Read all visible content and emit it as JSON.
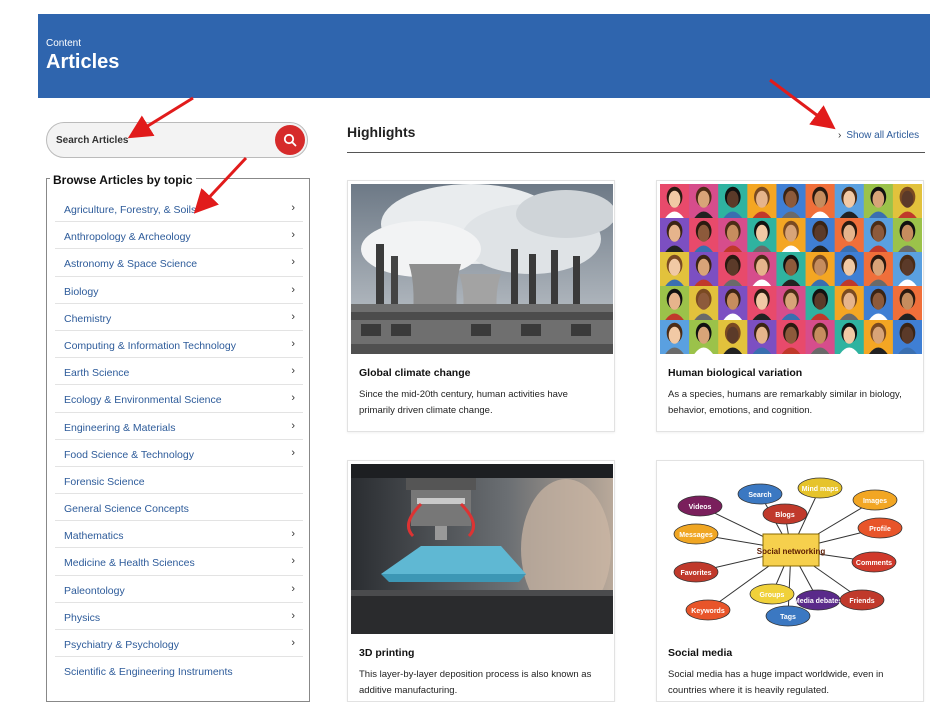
{
  "header": {
    "eyebrow": "Content",
    "title": "Articles"
  },
  "search": {
    "placeholder": "Search Articles",
    "icon": "search-icon",
    "button_color": "#d62b2b"
  },
  "topics": {
    "heading": "Browse Articles by topic",
    "items": [
      {
        "label": "Agriculture, Forestry, & Soils",
        "has_chevron": true
      },
      {
        "label": "Anthropology & Archeology",
        "has_chevron": true
      },
      {
        "label": "Astronomy & Space Science",
        "has_chevron": true
      },
      {
        "label": "Biology",
        "has_chevron": true
      },
      {
        "label": "Chemistry",
        "has_chevron": true
      },
      {
        "label": "Computing & Information Technology",
        "has_chevron": true
      },
      {
        "label": "Earth Science",
        "has_chevron": true
      },
      {
        "label": "Ecology & Environmental Science",
        "has_chevron": true
      },
      {
        "label": "Engineering & Materials",
        "has_chevron": true
      },
      {
        "label": "Food Science & Technology",
        "has_chevron": true
      },
      {
        "label": "Forensic Science",
        "has_chevron": false
      },
      {
        "label": "General Science Concepts",
        "has_chevron": false
      },
      {
        "label": "Mathematics",
        "has_chevron": true
      },
      {
        "label": "Medicine & Health Sciences",
        "has_chevron": true
      },
      {
        "label": "Paleontology",
        "has_chevron": true
      },
      {
        "label": "Physics",
        "has_chevron": true
      },
      {
        "label": "Psychiatry & Psychology",
        "has_chevron": true
      },
      {
        "label": "Scientific & Engineering Instruments",
        "has_chevron": false
      }
    ]
  },
  "highlights": {
    "title": "Highlights",
    "show_all_label": "Show all Articles",
    "cards": [
      {
        "title": "Global climate change",
        "description": "Since the mid-20th century, human activities have primarily driven climate change."
      },
      {
        "title": "Human biological variation",
        "description": "As a species, humans are remarkably similar in biology, behavior, emotions, and cognition."
      },
      {
        "title": "3D printing",
        "description": "This layer-by-layer deposition process is also known as additive manufacturing."
      },
      {
        "title": "Social media",
        "description": "Social media has a huge impact worldwide, even in countries where it is heavily regulated."
      }
    ]
  },
  "social_graphic": {
    "center": "Social networking",
    "bubbles": [
      "Videos",
      "Search",
      "Mind maps",
      "Images",
      "Blogs",
      "Messages",
      "Profile",
      "Comments",
      "Favorites",
      "Groups",
      "Media debates",
      "Friends",
      "Keywords",
      "Tags"
    ]
  },
  "colors": {
    "header_bg": "#2f65ae",
    "link": "#2d5b9a",
    "annotation_arrow": "#e11b1b"
  }
}
